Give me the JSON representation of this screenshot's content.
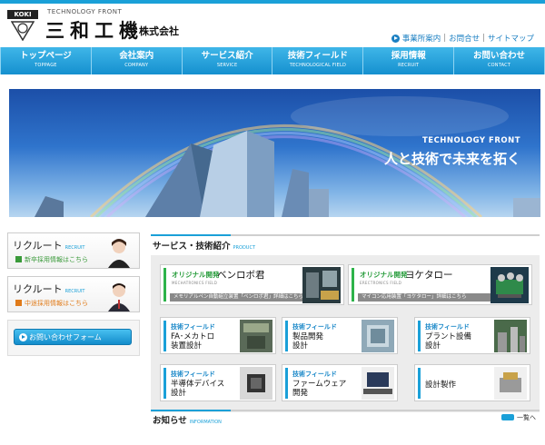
{
  "header": {
    "logo_badge": "KOKI",
    "tagline": "TECHNOLOGY FRONT",
    "company": "三和工機",
    "company_suffix": "株式会社",
    "util_links": [
      "事業所案内",
      "お問合せ",
      "サイトマップ"
    ]
  },
  "nav": [
    {
      "jp": "トップページ",
      "en": "TOPPAGE"
    },
    {
      "jp": "会社案内",
      "en": "COMPANY"
    },
    {
      "jp": "サービス紹介",
      "en": "SERVICE"
    },
    {
      "jp": "技術フィールド",
      "en": "TECHNOLOGICAL FIELD"
    },
    {
      "jp": "採用情報",
      "en": "RECRUIT"
    },
    {
      "jp": "お問い合わせ",
      "en": "CONTACT"
    }
  ],
  "hero": {
    "kicker": "TECHNOLOGY FRONT",
    "headline": "人と技術で未来を拓く"
  },
  "sidebar": {
    "recruit": [
      {
        "title": "リクルート",
        "en": "RECRUIT",
        "link": "新卒採用情報はこちら",
        "color": "#3a9a3a"
      },
      {
        "title": "リクルート",
        "en": "RECRUIT",
        "link": "中途採用情報はこちら",
        "color": "#e07b1a"
      }
    ],
    "contact_button": "お問い合わせフォーム"
  },
  "services": {
    "heading": "サービス・技術紹介",
    "heading_en": "PRODUCT",
    "featured": [
      {
        "category": "オリジナル開発",
        "name": "ベンロボ君",
        "en": "MECHATRONICS FIELD",
        "desc": "メモリアルペン自動組立装置「ベンロボ君」詳細はこちら"
      },
      {
        "category": "オリジナル開発",
        "name": "ヨケタロー",
        "en": "ERECTRONICS FIELD",
        "desc": "マイコン応用装置「ヨケタロー」詳細はこちら"
      }
    ],
    "fields": [
      {
        "category": "技術フィールド",
        "name": "FA･メカトロ\n装置設計"
      },
      {
        "category": "技術フィールド",
        "name": "製品開発\n設計"
      },
      {
        "category": "技術フィールド",
        "name": "プラント設備\n設計"
      },
      {
        "category": "技術フィールド",
        "name": "半導体デバイス\n設計"
      },
      {
        "category": "技術フィールド",
        "name": "ファームウェア\n開発"
      },
      {
        "category": "",
        "name": "設計製作"
      }
    ]
  },
  "news": {
    "heading": "お知らせ",
    "heading_en": "INFORMATION",
    "more": "一覧へ"
  }
}
